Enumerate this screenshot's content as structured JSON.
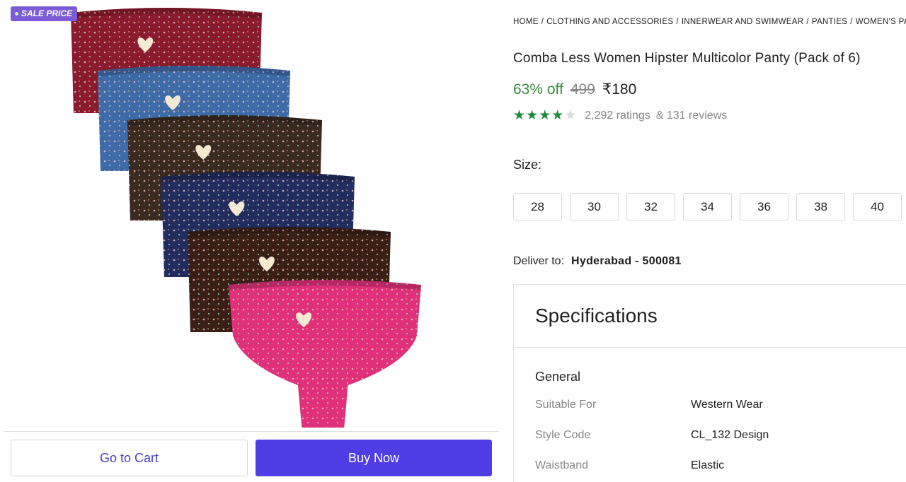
{
  "badge": {
    "label": "SALE PRICE"
  },
  "actions": {
    "cart_label": "Go to Cart",
    "buy_label": "Buy Now"
  },
  "breadcrumb": [
    "HOME",
    "CLOTHING AND ACCESSORIES",
    "INNERWEAR AND SWIMWEAR",
    "PANTIES",
    "WOMEN'S PANTIES"
  ],
  "product": {
    "title": "Comba Less Women Hipster Multicolor Panty (Pack of 6)",
    "discount": "63% off",
    "mrp": "499",
    "price": "₹180",
    "rating_stars": 4,
    "ratings_text": "2,292 ratings",
    "reviews_text": "& 131 reviews"
  },
  "size": {
    "label": "Size:",
    "options": [
      "28",
      "30",
      "32",
      "34",
      "36",
      "38",
      "40"
    ]
  },
  "delivery": {
    "label": "Deliver to:",
    "location": "Hyderabad - 500081"
  },
  "specifications": {
    "heading": "Specifications",
    "group": "General",
    "rows": [
      {
        "key": "Suitable For",
        "value": "Western Wear"
      },
      {
        "key": "Style Code",
        "value": "CL_132 Design"
      },
      {
        "key": "Waistband",
        "value": "Elastic"
      }
    ]
  },
  "image": {
    "colors": [
      "#8a1a2e",
      "#3e6aa8",
      "#3a2a20",
      "#232c5e",
      "#3a1f17",
      "#e0307a"
    ]
  }
}
